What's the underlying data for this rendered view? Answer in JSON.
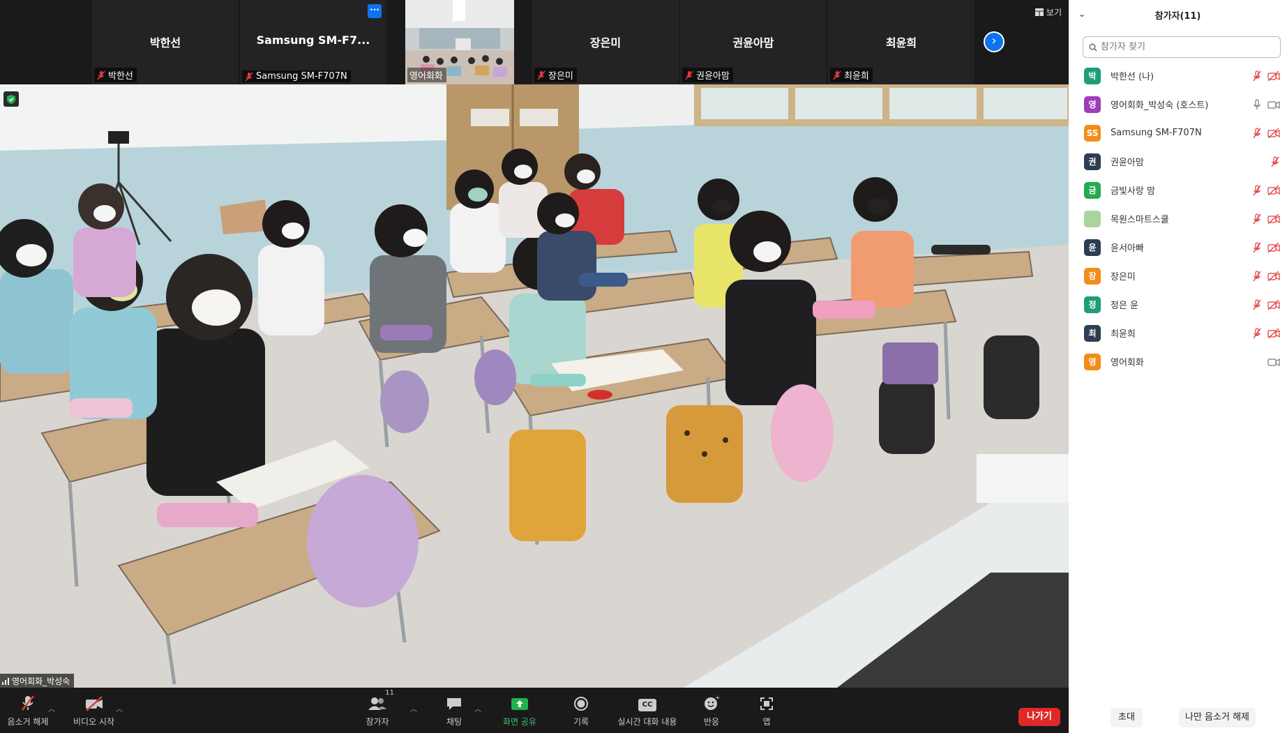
{
  "strip": {
    "tiles": [
      {
        "name": "박한선",
        "label": "박한선"
      },
      {
        "name": "Samsung  SM-F7...",
        "label": "Samsung SM-F707N"
      },
      {
        "name": "",
        "label": "영어회화"
      },
      {
        "name": "장은미",
        "label": "장은미"
      },
      {
        "name": "권윤아맘",
        "label": "권윤아맘"
      },
      {
        "name": "최윤희",
        "label": "최윤희"
      }
    ],
    "more_label": "···",
    "next_label": "›",
    "view_label": "보기"
  },
  "main": {
    "speaker_label": "영어회화_박성숙"
  },
  "toolbar": {
    "unmute": "음소거 해제",
    "start_video": "비디오 시작",
    "participants": "참가자",
    "participants_count": "11",
    "chat": "채팅",
    "share": "화면 공유",
    "record": "기록",
    "captions": "실시간 대화 내용",
    "reactions": "반응",
    "apps": "앱",
    "leave": "나가기",
    "cc_label": "CC"
  },
  "panel": {
    "title": "참가자(11)",
    "search_placeholder": "참가자 찾기",
    "participants": [
      {
        "initial": "박",
        "color": "#1f9d78",
        "name": "박한선 (나)",
        "mic": "off",
        "video": "off"
      },
      {
        "initial": "영",
        "color": "#9b3fb8",
        "name": "영어회화_박성숙 (호스트)",
        "mic": "on",
        "video": "on"
      },
      {
        "initial": "SS",
        "color": "#f28c1b",
        "name": "Samsung SM-F707N",
        "mic": "off",
        "video": "off"
      },
      {
        "initial": "권",
        "color": "#2c3e50",
        "name": "권윤아맘",
        "mic": "off",
        "video": "none"
      },
      {
        "initial": "금",
        "color": "#27a94f",
        "name": "금빛사랑 맘",
        "mic": "off",
        "video": "off"
      },
      {
        "initial": "",
        "color": "#a8d59a",
        "name": "목원스마트스쿨",
        "mic": "off",
        "video": "off"
      },
      {
        "initial": "윤",
        "color": "#2c3e50",
        "name": "윤서아빠",
        "mic": "off",
        "video": "off"
      },
      {
        "initial": "장",
        "color": "#f28c1b",
        "name": "장은미",
        "mic": "off",
        "video": "off"
      },
      {
        "initial": "정",
        "color": "#1f9d78",
        "name": "정은 윤",
        "mic": "off",
        "video": "off"
      },
      {
        "initial": "최",
        "color": "#2c3e50",
        "name": "최윤희",
        "mic": "off",
        "video": "off"
      },
      {
        "initial": "영",
        "color": "#f28c1b",
        "name": "영어회화",
        "mic": "none",
        "video": "on"
      }
    ],
    "invite": "초대",
    "unmute_me": "나만 음소거 해제"
  }
}
